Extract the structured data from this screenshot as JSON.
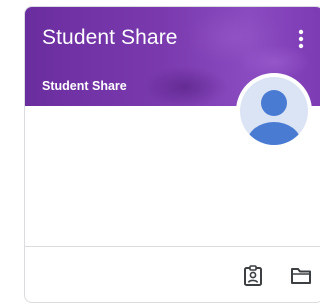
{
  "class_card": {
    "title": "Student Share",
    "subtitle": "Student Share",
    "banner_color": "#7a3aae",
    "avatar_color": "#4a7bd3"
  },
  "icons": {
    "more": "more-vert-icon",
    "avatar": "person-avatar-icon",
    "gradebook": "assignment-ind-icon",
    "folder": "folder-icon"
  }
}
